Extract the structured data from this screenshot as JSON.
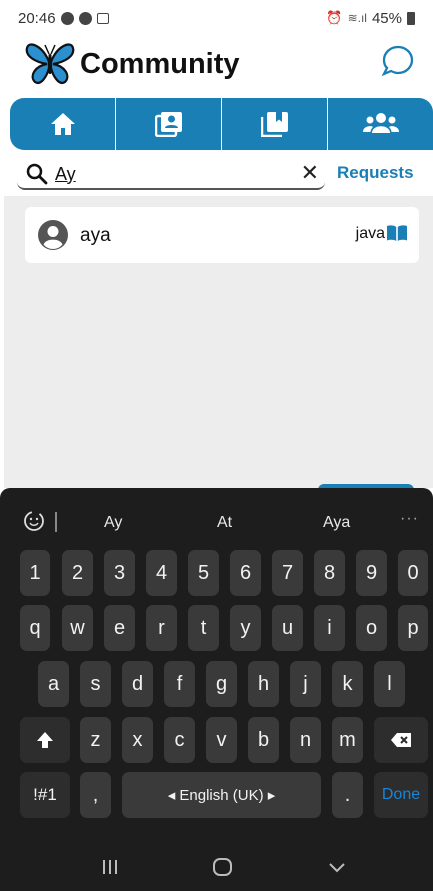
{
  "status_bar": {
    "time": "20:46",
    "battery": "45%"
  },
  "header": {
    "title": "Community",
    "brand_color": "#1a7fb5"
  },
  "tabs": [
    {
      "icon": "home-icon"
    },
    {
      "icon": "contact-book-icon"
    },
    {
      "icon": "bookmark-book-icon"
    },
    {
      "icon": "users-icon",
      "active": true
    }
  ],
  "search": {
    "value": "Ay",
    "requests_label": "Requests"
  },
  "results": [
    {
      "name": "aya",
      "language": "java"
    }
  ],
  "keyboard": {
    "suggestions": [
      "Ay",
      "At",
      "Aya"
    ],
    "rows": {
      "numbers": [
        "1",
        "2",
        "3",
        "4",
        "5",
        "6",
        "7",
        "8",
        "9",
        "0"
      ],
      "row1": [
        "q",
        "w",
        "e",
        "r",
        "t",
        "y",
        "u",
        "i",
        "o",
        "p"
      ],
      "row2": [
        "a",
        "s",
        "d",
        "f",
        "g",
        "h",
        "j",
        "k",
        "l"
      ],
      "row3": [
        "z",
        "x",
        "c",
        "v",
        "b",
        "n",
        "m"
      ]
    },
    "symbols_label": "!#1",
    "comma_label": ",",
    "space_label": "◂  English (UK)  ▸",
    "period_label": ".",
    "done_label": "Done"
  }
}
